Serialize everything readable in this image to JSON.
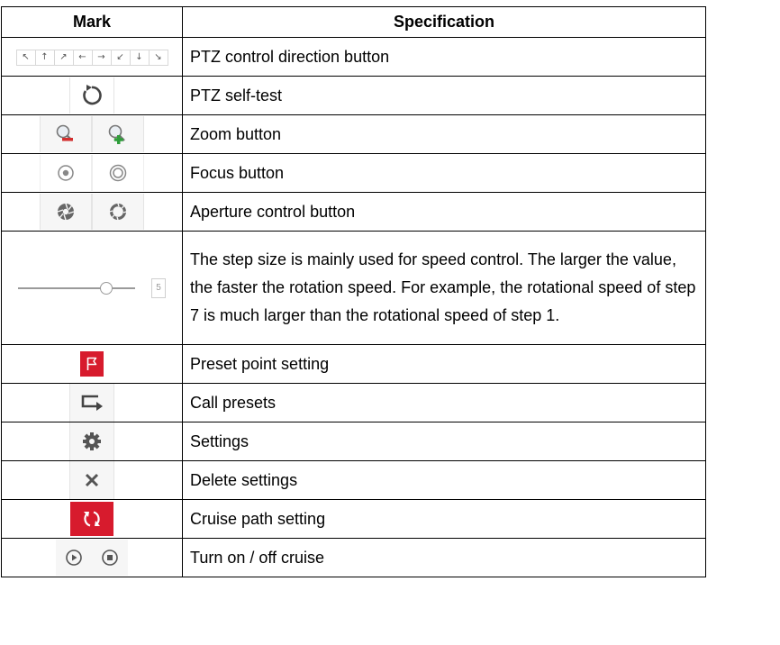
{
  "table": {
    "header": {
      "mark": "Mark",
      "spec": "Specification"
    },
    "rows": [
      {
        "spec": "PTZ control direction button"
      },
      {
        "spec": "PTZ self-test"
      },
      {
        "spec": "Zoom button"
      },
      {
        "spec": "Focus button"
      },
      {
        "spec": "Aperture control button"
      },
      {
        "spec": "The step size is mainly used for speed control. The larger the value, the faster the rotation speed. For example, the rotational speed of step 7 is much larger than the rotational speed of step 1."
      },
      {
        "spec": "Preset point setting"
      },
      {
        "spec": "Call presets"
      },
      {
        "spec": "Settings"
      },
      {
        "spec": "Delete settings"
      },
      {
        "spec": "Cruise path setting"
      },
      {
        "spec": "Turn on / off cruise"
      }
    ]
  },
  "direction_glyphs": [
    "↖",
    "↑",
    "↗",
    "←",
    "→",
    "↙",
    "↓",
    "↘"
  ],
  "step_slider": {
    "value": "5",
    "level": 0.75
  },
  "icons": {
    "row_1": "ptz-direction-buttons",
    "row_2": "self-test-refresh-icon",
    "row_3": [
      "zoom-out-icon",
      "zoom-in-icon"
    ],
    "row_4": [
      "focus-near-icon",
      "focus-far-icon"
    ],
    "row_5": [
      "aperture-close-icon",
      "aperture-open-icon"
    ],
    "row_6": "step-size-slider",
    "row_7": "preset-flag-icon",
    "row_8": "call-preset-icon",
    "row_9": "settings-gear-icon",
    "row_10": "delete-x-icon",
    "row_11": "cruise-path-icon",
    "row_12": [
      "cruise-play-icon",
      "cruise-stop-icon"
    ]
  },
  "colors": {
    "accent_red": "#d71b2d",
    "icon_gray": "#555555",
    "zoom_red": "#d32f2f",
    "zoom_green": "#2e9d3a"
  }
}
